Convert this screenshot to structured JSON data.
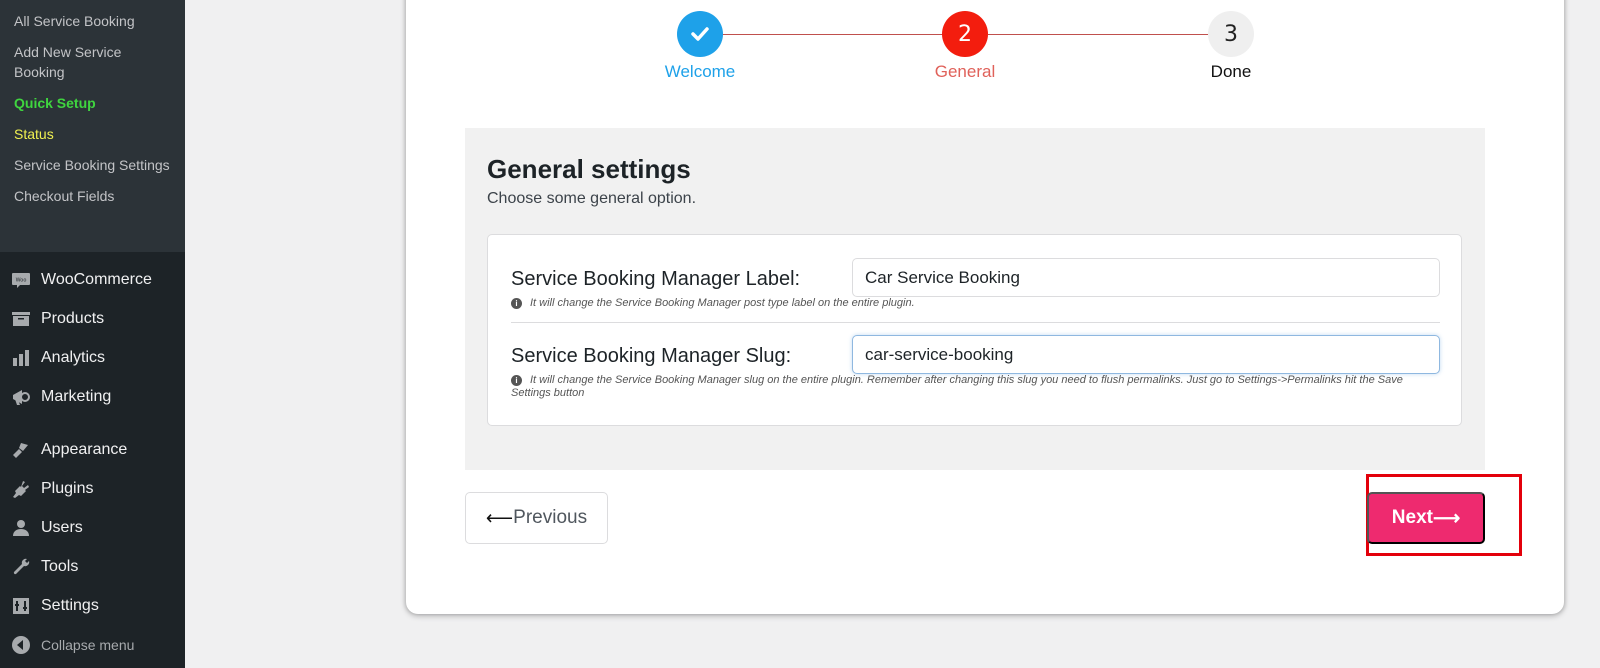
{
  "sidebar": {
    "submenu": [
      {
        "label": "All Service Booking",
        "state": "normal"
      },
      {
        "label": "Add New Service Booking",
        "state": "normal"
      },
      {
        "label": "Quick Setup",
        "state": "active"
      },
      {
        "label": "Status",
        "state": "highlight"
      },
      {
        "label": "Service Booking Settings",
        "state": "normal"
      },
      {
        "label": "Checkout Fields",
        "state": "normal"
      }
    ],
    "menu": [
      {
        "label": "WooCommerce",
        "icon": "woo-icon"
      },
      {
        "label": "Products",
        "icon": "archive-icon"
      },
      {
        "label": "Analytics",
        "icon": "bar-chart-icon"
      },
      {
        "label": "Marketing",
        "icon": "megaphone-icon"
      },
      {
        "label": "Appearance",
        "icon": "paintbrush-icon"
      },
      {
        "label": "Plugins",
        "icon": "plug-icon"
      },
      {
        "label": "Users",
        "icon": "user-icon"
      },
      {
        "label": "Tools",
        "icon": "wrench-icon"
      },
      {
        "label": "Settings",
        "icon": "sliders-icon"
      }
    ],
    "collapse_label": "Collapse menu"
  },
  "stepper": {
    "steps": [
      {
        "number": "1",
        "label": "Welcome",
        "status": "done"
      },
      {
        "number": "2",
        "label": "General",
        "status": "current"
      },
      {
        "number": "3",
        "label": "Done",
        "status": "todo"
      }
    ],
    "colors": {
      "done": "#1ea1e9",
      "current": "#f31d0e",
      "todo": "#efefef"
    }
  },
  "panel": {
    "title": "General settings",
    "subtitle": "Choose some general option.",
    "fields": [
      {
        "label": "Service Booking Manager Label:",
        "value": "Car Service Booking",
        "hint": "It will change the Service Booking Manager post type label on the entire plugin."
      },
      {
        "label": "Service Booking Manager Slug:",
        "value": "car-service-booking",
        "hint": "It will change the Service Booking Manager slug on the entire plugin. Remember after changing this slug you need to flush permalinks. Just go to Settings->Permalinks hit the Save Settings button"
      }
    ]
  },
  "buttons": {
    "previous_arrow": "⟵",
    "previous_label": "Previous",
    "next_label": "Next",
    "next_arrow": "⟶",
    "next_color": "#ee2a6f"
  }
}
